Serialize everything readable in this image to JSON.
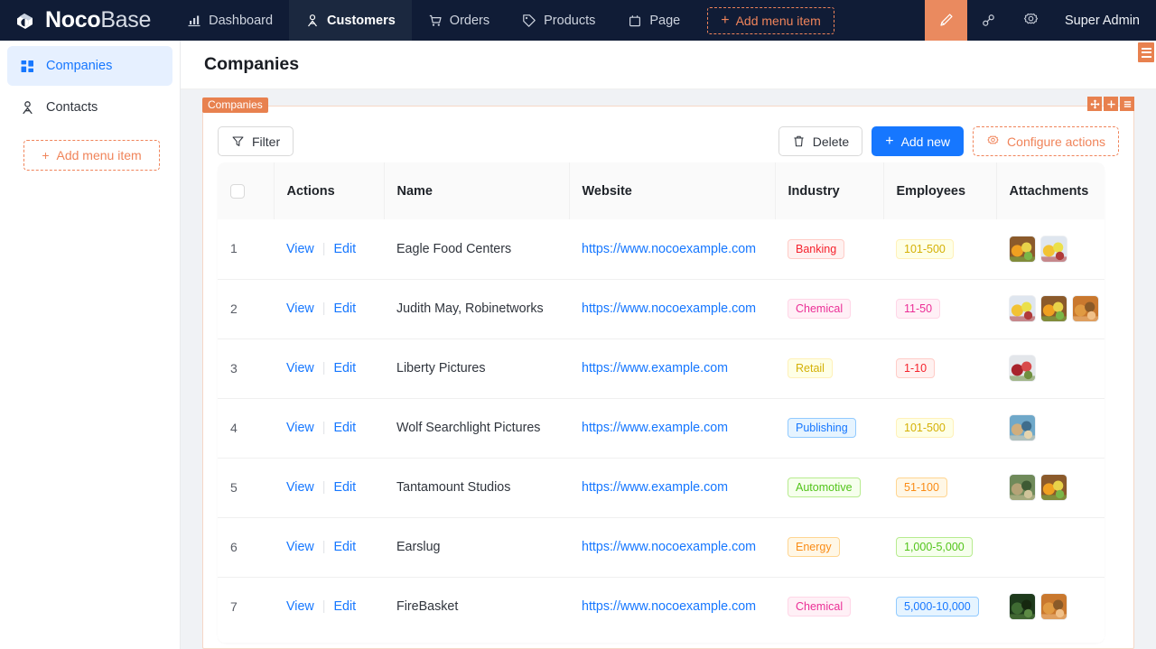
{
  "brand": {
    "name_bold": "Noco",
    "name_thin": "Base",
    "logo_icon": "nocobase-cube-icon"
  },
  "topnav": {
    "items": [
      {
        "label": "Dashboard",
        "icon": "bar-chart-icon",
        "active": false
      },
      {
        "label": "Customers",
        "icon": "user-group-icon",
        "active": true
      },
      {
        "label": "Orders",
        "icon": "shopping-cart-icon",
        "active": false
      },
      {
        "label": "Products",
        "icon": "tag-icon",
        "active": false
      },
      {
        "label": "Page",
        "icon": "layout-icon",
        "active": false
      }
    ],
    "add_menu_item": "Add menu item",
    "plus": "+",
    "right_icons": [
      {
        "name": "ui-editor-pen-icon",
        "active": true
      },
      {
        "name": "plugin-settings-icon",
        "active": false
      },
      {
        "name": "gear-icon",
        "active": false
      }
    ],
    "user": "Super Admin"
  },
  "sidebar": {
    "items": [
      {
        "label": "Companies",
        "icon": "grid-blocks-icon",
        "active": true
      },
      {
        "label": "Contacts",
        "icon": "user-group-icon",
        "active": false
      }
    ],
    "add_menu_item": "Add menu item",
    "plus": "+"
  },
  "page": {
    "title": "Companies",
    "menu_button": "page-designer-menu"
  },
  "block": {
    "tag_label": "Companies",
    "tools": [
      "drag-move-icon",
      "plus-icon",
      "menu-icon"
    ]
  },
  "toolbar": {
    "filter_label": "Filter",
    "delete_label": "Delete",
    "add_new_label": "Add new",
    "configure_actions_label": "Configure actions",
    "add_new_plus": "+"
  },
  "table": {
    "columns": [
      "",
      "Actions",
      "Name",
      "Website",
      "Industry",
      "Employees",
      "Attachments"
    ],
    "action_view": "View",
    "action_edit": "Edit",
    "rows": [
      {
        "num": "1",
        "name": "Eagle Food Centers",
        "website": "https://www.nocoexample.com",
        "industry": "Banking",
        "industry_color": "red",
        "employees": "101-500",
        "employees_color": "yellow",
        "attachments": [
          "fruit-basket-photo",
          "citrus-fruit-photo"
        ]
      },
      {
        "num": "2",
        "name": "Judith May, Robinetworks",
        "website": "https://www.nocoexample.com",
        "industry": "Chemical",
        "industry_color": "magenta",
        "employees": "11-50",
        "employees_color": "magenta",
        "attachments": [
          "citrus-fruit-photo",
          "fruit-basket-photo",
          "desert-road-photo"
        ]
      },
      {
        "num": "3",
        "name": "Liberty Pictures",
        "website": "https://www.example.com",
        "industry": "Retail",
        "industry_color": "yellow",
        "employees": "1-10",
        "employees_color": "red",
        "attachments": [
          "berries-photo"
        ]
      },
      {
        "num": "4",
        "name": "Wolf Searchlight Pictures",
        "website": "https://www.example.com",
        "industry": "Publishing",
        "industry_color": "blue",
        "employees": "101-500",
        "employees_color": "yellow",
        "attachments": [
          "beach-landscape-photo"
        ]
      },
      {
        "num": "5",
        "name": "Tantamount Studios",
        "website": "https://www.example.com",
        "industry": "Automotive",
        "industry_color": "green",
        "employees": "51-100",
        "employees_color": "orange",
        "attachments": [
          "tree-landscape-photo",
          "fruit-basket-photo"
        ]
      },
      {
        "num": "6",
        "name": "Earslug",
        "website": "https://www.nocoexample.com",
        "industry": "Energy",
        "industry_color": "orange",
        "employees": "1,000-5,000",
        "employees_color": "green",
        "attachments": []
      },
      {
        "num": "7",
        "name": "FireBasket",
        "website": "https://www.nocoexample.com",
        "industry": "Chemical",
        "industry_color": "magenta",
        "employees": "5,000-10,000",
        "employees_color": "blue",
        "attachments": [
          "forest-photo",
          "desert-road-photo"
        ]
      }
    ]
  },
  "colors": {
    "header_bg": "#101c36",
    "accent_orange": "#e8814f",
    "primary_blue": "#1677ff",
    "sidebar_active_bg": "#e6f0ff",
    "page_bg": "#f0f2f5"
  }
}
